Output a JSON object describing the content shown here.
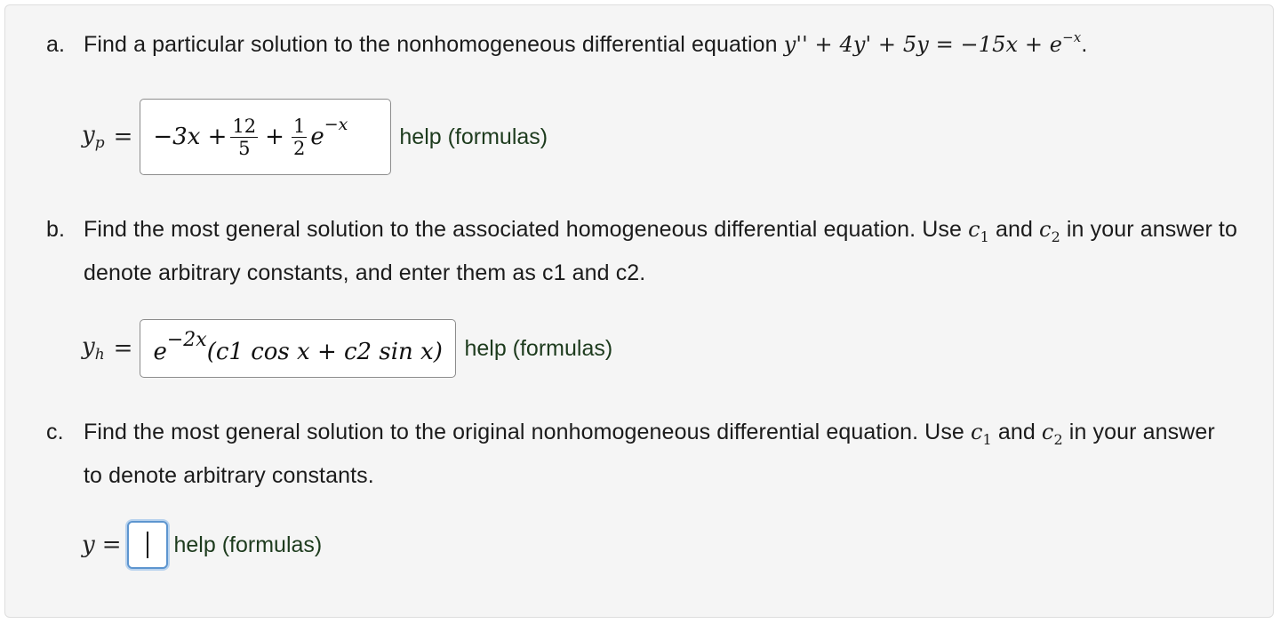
{
  "part_a": {
    "letter": "a.",
    "question": "Find a particular solution to the nonhomogeneous differential equation",
    "equation": "y'' + 4y' + 5y = −15x + e",
    "equation_exp": "−x",
    "period": ".",
    "lhs_var": "y",
    "lhs_sub": "p",
    "answer": {
      "term1": "−3x +",
      "frac1_num": "12",
      "frac1_den": "5",
      "plus": "+",
      "frac2_num": "1",
      "frac2_den": "2",
      "base": "e",
      "exp": "−x"
    },
    "help": "help (formulas)"
  },
  "part_b": {
    "letter": "b.",
    "question_1": "Find the most general solution to the associated homogeneous differential equation. Use",
    "c1": "c",
    "c1_sub": "1",
    "and": "and",
    "c2": "c",
    "c2_sub": "2",
    "question_2": "in your answer to denote arbitrary constants, and enter them as c1 and c2.",
    "lhs_var": "y",
    "lhs_sub": "h",
    "answer": {
      "base": "e",
      "exp": "−2x",
      "body": "(c1 cos x + c2 sin x)"
    },
    "help": "help (formulas)"
  },
  "part_c": {
    "letter": "c.",
    "question_1": "Find the most general solution to the original nonhomogeneous differential equation. Use",
    "c1": "c",
    "c1_sub": "1",
    "and": "and",
    "c2": "c",
    "c2_sub": "2",
    "question_2": "in your answer to denote arbitrary constants.",
    "lhs_var": "y",
    "answer_value": "",
    "help": "help (formulas)"
  },
  "symbols": {
    "equals": "="
  }
}
